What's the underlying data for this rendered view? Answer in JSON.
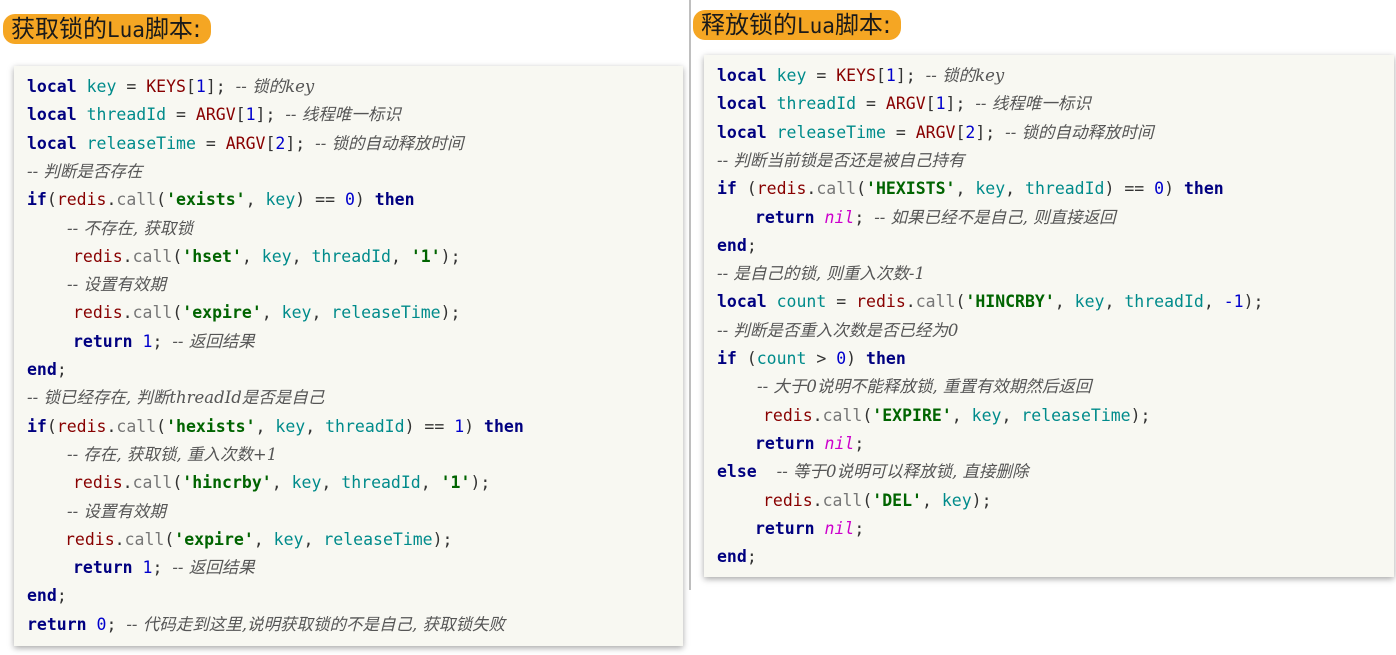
{
  "left": {
    "title_cn_1": "获取锁的",
    "title_lua": "Lua",
    "title_cn_2": "脚本:",
    "lines": [
      {
        "indent": 0,
        "tokens": [
          [
            "kw",
            "local"
          ],
          [
            "op",
            " "
          ],
          [
            "var",
            "key"
          ],
          [
            "op",
            " = "
          ],
          [
            "glob",
            "KEYS"
          ],
          [
            "op",
            "["
          ],
          [
            "num",
            "1"
          ],
          [
            "op",
            "]; "
          ],
          [
            "cm",
            "-- 锁的key"
          ]
        ]
      },
      {
        "indent": 0,
        "tokens": [
          [
            "kw",
            "local"
          ],
          [
            "op",
            " "
          ],
          [
            "var",
            "threadId"
          ],
          [
            "op",
            " = "
          ],
          [
            "glob",
            "ARGV"
          ],
          [
            "op",
            "["
          ],
          [
            "num",
            "1"
          ],
          [
            "op",
            "]; "
          ],
          [
            "cm",
            "-- 线程唯一标识"
          ]
        ]
      },
      {
        "indent": 0,
        "tokens": [
          [
            "kw",
            "local"
          ],
          [
            "op",
            " "
          ],
          [
            "var",
            "releaseTime"
          ],
          [
            "op",
            " = "
          ],
          [
            "glob",
            "ARGV"
          ],
          [
            "op",
            "["
          ],
          [
            "num",
            "2"
          ],
          [
            "op",
            "]; "
          ],
          [
            "cm",
            "-- 锁的自动释放时间"
          ]
        ]
      },
      {
        "indent": 0,
        "tokens": [
          [
            "cm",
            "-- 判断是否存在"
          ]
        ]
      },
      {
        "indent": 0,
        "tokens": [
          [
            "kw",
            "if"
          ],
          [
            "op",
            "("
          ],
          [
            "fn",
            "redis"
          ],
          [
            "op",
            "."
          ],
          [
            "call",
            "call"
          ],
          [
            "op",
            "("
          ],
          [
            "str",
            "'exists'"
          ],
          [
            "op",
            ", "
          ],
          [
            "var",
            "key"
          ],
          [
            "op",
            ") == "
          ],
          [
            "num",
            "0"
          ],
          [
            "op",
            ") "
          ],
          [
            "kw",
            "then"
          ]
        ]
      },
      {
        "indent": 40,
        "tokens": [
          [
            "cm",
            "-- 不存在, 获取锁"
          ]
        ]
      },
      {
        "indent": 46,
        "tokens": [
          [
            "fn",
            "redis"
          ],
          [
            "op",
            "."
          ],
          [
            "call",
            "call"
          ],
          [
            "op",
            "("
          ],
          [
            "str",
            "'hset'"
          ],
          [
            "op",
            ", "
          ],
          [
            "var",
            "key"
          ],
          [
            "op",
            ", "
          ],
          [
            "var",
            "threadId"
          ],
          [
            "op",
            ", "
          ],
          [
            "str",
            "'1'"
          ],
          [
            "op",
            ");"
          ]
        ]
      },
      {
        "indent": 40,
        "tokens": [
          [
            "cm",
            "-- 设置有效期"
          ]
        ]
      },
      {
        "indent": 46,
        "tokens": [
          [
            "fn",
            "redis"
          ],
          [
            "op",
            "."
          ],
          [
            "call",
            "call"
          ],
          [
            "op",
            "("
          ],
          [
            "str",
            "'expire'"
          ],
          [
            "op",
            ", "
          ],
          [
            "var",
            "key"
          ],
          [
            "op",
            ", "
          ],
          [
            "var",
            "releaseTime"
          ],
          [
            "op",
            ");"
          ]
        ]
      },
      {
        "indent": 46,
        "tokens": [
          [
            "kw",
            "return"
          ],
          [
            "op",
            " "
          ],
          [
            "num",
            "1"
          ],
          [
            "op",
            "; "
          ],
          [
            "cm",
            "-- 返回结果"
          ]
        ]
      },
      {
        "indent": 0,
        "tokens": [
          [
            "kw",
            "end"
          ],
          [
            "op",
            ";"
          ]
        ]
      },
      {
        "indent": 0,
        "tokens": [
          [
            "cm",
            "-- 锁已经存在, 判断threadId是否是自己"
          ]
        ]
      },
      {
        "indent": 0,
        "tokens": [
          [
            "kw",
            "if"
          ],
          [
            "op",
            "("
          ],
          [
            "fn",
            "redis"
          ],
          [
            "op",
            "."
          ],
          [
            "call",
            "call"
          ],
          [
            "op",
            "("
          ],
          [
            "str",
            "'hexists'"
          ],
          [
            "op",
            ", "
          ],
          [
            "var",
            "key"
          ],
          [
            "op",
            ", "
          ],
          [
            "var",
            "threadId"
          ],
          [
            "op",
            ") == "
          ],
          [
            "num",
            "1"
          ],
          [
            "op",
            ") "
          ],
          [
            "kw",
            "then"
          ]
        ]
      },
      {
        "indent": 40,
        "tokens": [
          [
            "cm",
            "-- 存在, 获取锁, 重入次数+1"
          ]
        ]
      },
      {
        "indent": 46,
        "tokens": [
          [
            "fn",
            "redis"
          ],
          [
            "op",
            "."
          ],
          [
            "call",
            "call"
          ],
          [
            "op",
            "("
          ],
          [
            "str",
            "'hincrby'"
          ],
          [
            "op",
            ", "
          ],
          [
            "var",
            "key"
          ],
          [
            "op",
            ", "
          ],
          [
            "var",
            "threadId"
          ],
          [
            "op",
            ", "
          ],
          [
            "str",
            "'1'"
          ],
          [
            "op",
            ");"
          ]
        ]
      },
      {
        "indent": 40,
        "tokens": [
          [
            "cm",
            "-- 设置有效期"
          ]
        ]
      },
      {
        "indent": 38,
        "tokens": [
          [
            "fn",
            "redis"
          ],
          [
            "op",
            "."
          ],
          [
            "call",
            "call"
          ],
          [
            "op",
            "("
          ],
          [
            "str",
            "'expire'"
          ],
          [
            "op",
            ", "
          ],
          [
            "var",
            "key"
          ],
          [
            "op",
            ", "
          ],
          [
            "var",
            "releaseTime"
          ],
          [
            "op",
            ");"
          ]
        ]
      },
      {
        "indent": 46,
        "tokens": [
          [
            "kw",
            "return"
          ],
          [
            "op",
            " "
          ],
          [
            "num",
            "1"
          ],
          [
            "op",
            "; "
          ],
          [
            "cm",
            "-- 返回结果"
          ]
        ]
      },
      {
        "indent": 0,
        "tokens": [
          [
            "kw",
            "end"
          ],
          [
            "op",
            ";"
          ]
        ]
      },
      {
        "indent": 0,
        "tokens": [
          [
            "kw",
            "return"
          ],
          [
            "op",
            " "
          ],
          [
            "num",
            "0"
          ],
          [
            "op",
            "; "
          ],
          [
            "cm",
            "-- 代码走到这里,说明获取锁的不是自己, 获取锁失败"
          ]
        ]
      }
    ]
  },
  "right": {
    "title_cn_1": "释放锁的",
    "title_lua": "Lua",
    "title_cn_2": "脚本:",
    "lines": [
      {
        "indent": 0,
        "tokens": [
          [
            "kw",
            "local"
          ],
          [
            "op",
            " "
          ],
          [
            "var",
            "key"
          ],
          [
            "op",
            " = "
          ],
          [
            "glob",
            "KEYS"
          ],
          [
            "op",
            "["
          ],
          [
            "num",
            "1"
          ],
          [
            "op",
            "]; "
          ],
          [
            "cm",
            "-- 锁的key"
          ]
        ]
      },
      {
        "indent": 0,
        "tokens": [
          [
            "kw",
            "local"
          ],
          [
            "op",
            " "
          ],
          [
            "var",
            "threadId"
          ],
          [
            "op",
            " = "
          ],
          [
            "glob",
            "ARGV"
          ],
          [
            "op",
            "["
          ],
          [
            "num",
            "1"
          ],
          [
            "op",
            "]; "
          ],
          [
            "cm",
            "-- 线程唯一标识"
          ]
        ]
      },
      {
        "indent": 0,
        "tokens": [
          [
            "kw",
            "local"
          ],
          [
            "op",
            " "
          ],
          [
            "var",
            "releaseTime"
          ],
          [
            "op",
            " = "
          ],
          [
            "glob",
            "ARGV"
          ],
          [
            "op",
            "["
          ],
          [
            "num",
            "2"
          ],
          [
            "op",
            "]; "
          ],
          [
            "cm",
            "-- 锁的自动释放时间"
          ]
        ]
      },
      {
        "indent": 0,
        "tokens": [
          [
            "cm",
            "-- 判断当前锁是否还是被自己持有"
          ]
        ]
      },
      {
        "indent": 0,
        "tokens": [
          [
            "kw",
            "if"
          ],
          [
            "op",
            " ("
          ],
          [
            "fn",
            "redis"
          ],
          [
            "op",
            "."
          ],
          [
            "call",
            "call"
          ],
          [
            "op",
            "("
          ],
          [
            "str",
            "'HEXISTS'"
          ],
          [
            "op",
            ", "
          ],
          [
            "var",
            "key"
          ],
          [
            "op",
            ", "
          ],
          [
            "var",
            "threadId"
          ],
          [
            "op",
            ") == "
          ],
          [
            "num",
            "0"
          ],
          [
            "op",
            ") "
          ],
          [
            "kw",
            "then"
          ]
        ]
      },
      {
        "indent": 38,
        "tokens": [
          [
            "kw",
            "return"
          ],
          [
            "op",
            " "
          ],
          [
            "nil",
            "nil"
          ],
          [
            "op",
            "; "
          ],
          [
            "cm",
            "-- 如果已经不是自己, 则直接返回"
          ]
        ]
      },
      {
        "indent": 0,
        "tokens": [
          [
            "kw",
            "end"
          ],
          [
            "op",
            ";"
          ]
        ]
      },
      {
        "indent": 0,
        "tokens": [
          [
            "cm",
            "-- 是自己的锁, 则重入次数-1"
          ]
        ]
      },
      {
        "indent": 0,
        "tokens": [
          [
            "kw",
            "local"
          ],
          [
            "op",
            " "
          ],
          [
            "var",
            "count"
          ],
          [
            "op",
            " = "
          ],
          [
            "fn",
            "redis"
          ],
          [
            "op",
            "."
          ],
          [
            "call",
            "call"
          ],
          [
            "op",
            "("
          ],
          [
            "str",
            "'HINCRBY'"
          ],
          [
            "op",
            ", "
          ],
          [
            "var",
            "key"
          ],
          [
            "op",
            ", "
          ],
          [
            "var",
            "threadId"
          ],
          [
            "op",
            ", "
          ],
          [
            "num",
            "-1"
          ],
          [
            "op",
            ");"
          ]
        ]
      },
      {
        "indent": 0,
        "tokens": [
          [
            "cm",
            "-- 判断是否重入次数是否已经为0"
          ]
        ]
      },
      {
        "indent": 0,
        "tokens": [
          [
            "kw",
            "if"
          ],
          [
            "op",
            " ("
          ],
          [
            "var",
            "count"
          ],
          [
            "op",
            " > "
          ],
          [
            "num",
            "0"
          ],
          [
            "op",
            ") "
          ],
          [
            "kw",
            "then"
          ]
        ]
      },
      {
        "indent": 40,
        "tokens": [
          [
            "cm",
            "-- 大于0说明不能释放锁, 重置有效期然后返回"
          ]
        ]
      },
      {
        "indent": 46,
        "tokens": [
          [
            "fn",
            "redis"
          ],
          [
            "op",
            "."
          ],
          [
            "call",
            "call"
          ],
          [
            "op",
            "("
          ],
          [
            "str",
            "'EXPIRE'"
          ],
          [
            "op",
            ", "
          ],
          [
            "var",
            "key"
          ],
          [
            "op",
            ", "
          ],
          [
            "var",
            "releaseTime"
          ],
          [
            "op",
            ");"
          ]
        ]
      },
      {
        "indent": 38,
        "tokens": [
          [
            "kw",
            "return"
          ],
          [
            "op",
            " "
          ],
          [
            "nil",
            "nil"
          ],
          [
            "op",
            ";"
          ]
        ]
      },
      {
        "indent": 0,
        "tokens": [
          [
            "kw",
            "else"
          ],
          [
            "op",
            "  "
          ],
          [
            "cm",
            "-- 等于0说明可以释放锁, 直接删除"
          ]
        ]
      },
      {
        "indent": 46,
        "tokens": [
          [
            "fn",
            "redis"
          ],
          [
            "op",
            "."
          ],
          [
            "call",
            "call"
          ],
          [
            "op",
            "("
          ],
          [
            "str",
            "'DEL'"
          ],
          [
            "op",
            ", "
          ],
          [
            "var",
            "key"
          ],
          [
            "op",
            ");"
          ]
        ]
      },
      {
        "indent": 38,
        "tokens": [
          [
            "kw",
            "return"
          ],
          [
            "op",
            " "
          ],
          [
            "nil",
            "nil"
          ],
          [
            "op",
            ";"
          ]
        ]
      },
      {
        "indent": 0,
        "tokens": [
          [
            "kw",
            "end"
          ],
          [
            "op",
            ";"
          ]
        ]
      }
    ]
  }
}
